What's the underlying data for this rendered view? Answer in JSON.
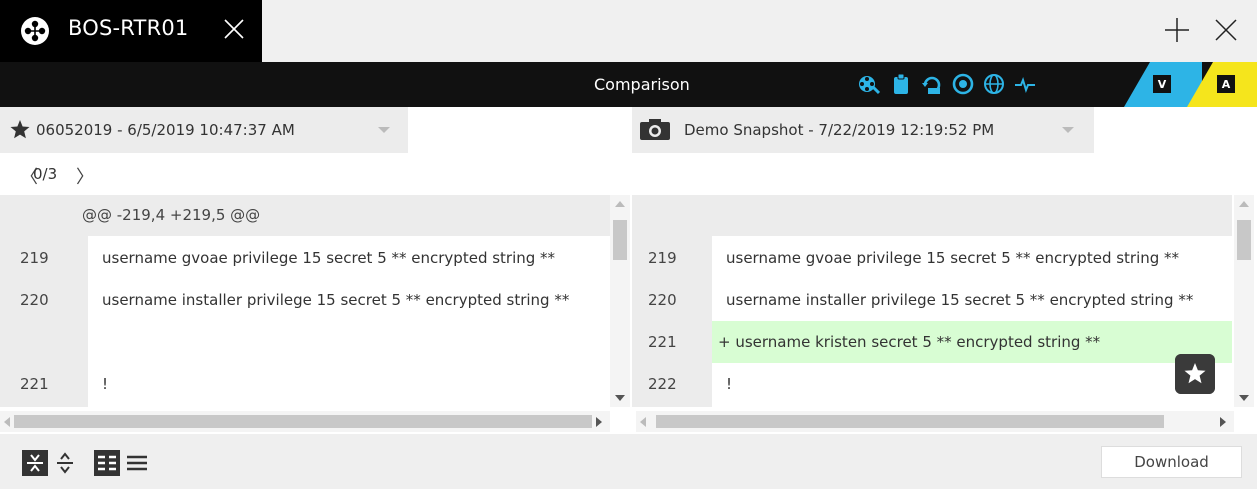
{
  "window": {
    "tab_title": "BOS-RTR01",
    "logo_icon": "network-node-icon",
    "close_tab_icon": "close-icon",
    "new_tab_icon": "plus-icon",
    "close_window_icon": "close-icon"
  },
  "toolbar": {
    "title": "Comparison",
    "accent": "#2db4e6",
    "icons": [
      "device-icon",
      "clipboard-icon",
      "restore-icon",
      "eye-icon",
      "globe-icon",
      "pulse-icon"
    ],
    "badge_v": "V",
    "badge_a": "A"
  },
  "snapshots": {
    "left": {
      "icon": "star-icon",
      "label": "06052019 - 6/5/2019 10:47:37 AM"
    },
    "right": {
      "icon": "camera-icon",
      "label": "Demo Snapshot - 7/22/2019 12:19:52 PM"
    }
  },
  "pager": {
    "prev": "〈",
    "text": "0/3",
    "next": "〉"
  },
  "diff": {
    "hunk_header": "@@ -219,4 +219,5 @@",
    "left_rows": [
      {
        "ln": "219",
        "code": "username gvoae privilege 15 secret 5 ** encrypted string **"
      },
      {
        "ln": "220",
        "code": "username installer privilege 15 secret 5 ** encrypted string **"
      },
      {
        "ln": "",
        "code": ""
      },
      {
        "ln": "221",
        "code": "!"
      }
    ],
    "right_rows": [
      {
        "ln": "219",
        "code": "username gvoae privilege 15 secret 5 ** encrypted string **",
        "added": false
      },
      {
        "ln": "220",
        "code": "username installer privilege 15 secret 5 ** encrypted string **",
        "added": false
      },
      {
        "ln": "221",
        "code": "+ username kristen secret 5 ** encrypted string **",
        "added": true
      },
      {
        "ln": "222",
        "code": "!",
        "added": false
      }
    ],
    "added_color": "#d8fdd3"
  },
  "bottombar": {
    "icons": [
      "collapse-icon",
      "expand-icon",
      "side-by-side-icon",
      "inline-icon"
    ],
    "download_label": "Download"
  }
}
